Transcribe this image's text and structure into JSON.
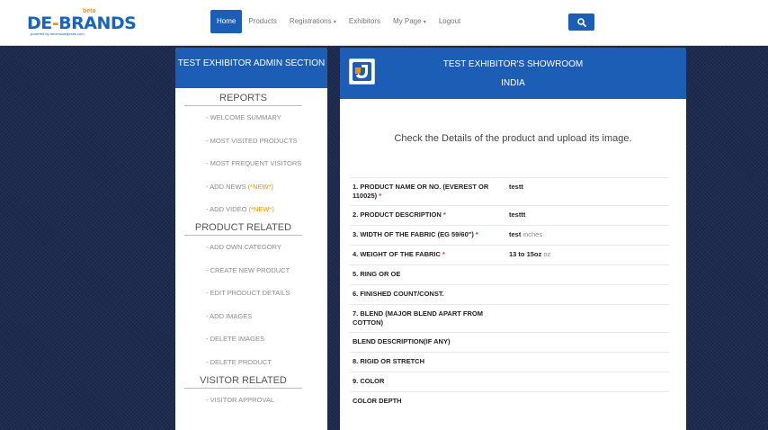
{
  "header": {
    "logo_text": "DE-BRANDS",
    "logo_badge": "beta",
    "logo_tagline": "powered by denimsandjeans.com",
    "nav": [
      {
        "label": "Home",
        "active": true
      },
      {
        "label": "Products"
      },
      {
        "label": "Registrations",
        "caret": "▾"
      },
      {
        "label": "Exhibitors"
      },
      {
        "label": "My Page",
        "caret": "▾"
      },
      {
        "label": "Logout"
      }
    ],
    "search_icon": "search-icon"
  },
  "sidebar": {
    "title": "TEST EXHIBITOR ADMIN SECTION",
    "sections": [
      {
        "title": "REPORTS",
        "links": [
          {
            "label": "- WELCOME SUMMARY"
          },
          {
            "label": "- MOST VISITED PRODUCTS"
          },
          {
            "label": "- MOST FREQUENT VISITORS"
          },
          {
            "label": "- ADD NEWS ",
            "badge": "(*NEW*)"
          },
          {
            "label": "- ADD VIDEO ",
            "badge": "(*NEW*)"
          }
        ]
      },
      {
        "title": "PRODUCT RELATED",
        "links": [
          {
            "label": "- ADD OWN CATEGORY"
          },
          {
            "label": "- CREATE NEW PRODUCT"
          },
          {
            "label": "- EDIT PRODUCT DETAILS"
          },
          {
            "label": "- ADD IMAGES"
          },
          {
            "label": "- DELETE IMAGES"
          },
          {
            "label": "- DELETE PRODUCT"
          }
        ]
      },
      {
        "title": "VISITOR RELATED",
        "links": [
          {
            "label": "- VISITOR APPROVAL"
          }
        ]
      }
    ]
  },
  "panel": {
    "title": "TEST EXHIBITOR'S SHOWROOM",
    "country": "INDIA",
    "intro": "Check the Details of the product and upload its image.",
    "fields": [
      {
        "label": "1. PRODUCT NAME OR NO. (EVEREST OR 110025)",
        "required": true,
        "value": "testt",
        "unit": ""
      },
      {
        "label": "2. PRODUCT DESCRIPTION",
        "required": true,
        "value": "testtt",
        "unit": ""
      },
      {
        "label": "3. WIDTH OF THE FABRIC (EG 59/60\")",
        "required": true,
        "value": "test",
        "unit": " inches"
      },
      {
        "label": "4. WEIGHT OF THE FABRIC",
        "required": true,
        "value": "13 to 15oz",
        "unit": " oz"
      },
      {
        "label": "5. RING OR OE",
        "required": false,
        "value": "",
        "unit": ""
      },
      {
        "label": "6. FINISHED COUNT/CONST.",
        "required": false,
        "value": "",
        "unit": ""
      },
      {
        "label": "7. BLEND (MAJOR BLEND APART FROM COTTON)",
        "required": false,
        "value": "",
        "unit": ""
      },
      {
        "label": "BLEND DESCRIPTION(IF ANY)",
        "required": false,
        "value": "",
        "unit": ""
      },
      {
        "label": "8. RIGID OR STRETCH",
        "required": false,
        "value": "",
        "unit": ""
      },
      {
        "label": "9. COLOR",
        "required": false,
        "value": "",
        "unit": ""
      },
      {
        "label": "COLOR DEPTH",
        "required": false,
        "value": "",
        "unit": ""
      }
    ]
  },
  "colors": {
    "accent": "#1c5db5",
    "new_badge": "#f39200",
    "required": "#e03030",
    "background": "#1d2a4e"
  }
}
